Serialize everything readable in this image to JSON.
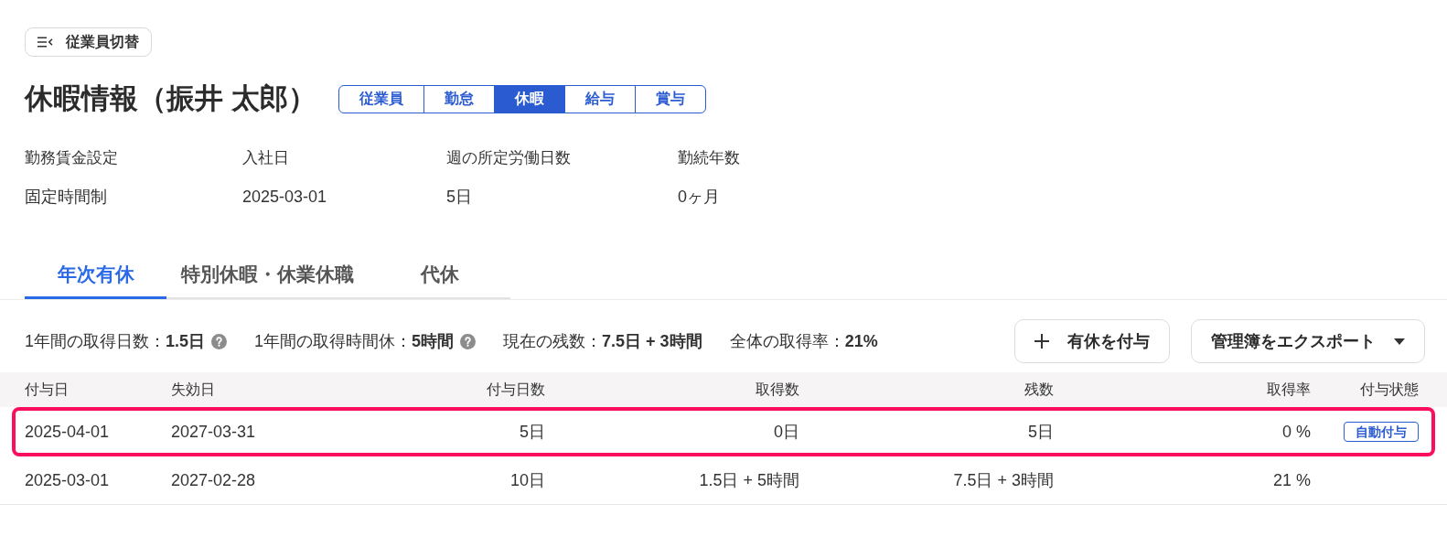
{
  "header": {
    "switch_button": "従業員切替",
    "title": "休暇情報（振井 太郎）"
  },
  "section_tabs": [
    {
      "label": "従業員",
      "selected": false
    },
    {
      "label": "勤怠",
      "selected": false
    },
    {
      "label": "休暇",
      "selected": true
    },
    {
      "label": "給与",
      "selected": false
    },
    {
      "label": "賞与",
      "selected": false
    }
  ],
  "employee_info": [
    {
      "label": "勤務賃金設定",
      "value": "固定時間制"
    },
    {
      "label": "入社日",
      "value": "2025-03-01"
    },
    {
      "label": "週の所定労働日数",
      "value": "5日"
    },
    {
      "label": "勤続年数",
      "value": "0ヶ月"
    }
  ],
  "leave_tabs": [
    {
      "label": "年次有休",
      "selected": true
    },
    {
      "label": "特別休暇・休業休職",
      "selected": false
    },
    {
      "label": "代休",
      "selected": false
    }
  ],
  "summary": [
    {
      "text": "1年間の取得日数：**1.5日**",
      "help": true
    },
    {
      "text": "1年間の取得時間休：**5時間**",
      "help": true
    },
    {
      "text": "現在の残数：**7.5日 + 3時間**",
      "help": false
    },
    {
      "text": "全体の取得率：**21%**",
      "help": false
    }
  ],
  "actions": [
    {
      "kind": "add",
      "label": "有休を付与"
    },
    {
      "kind": "dropdown",
      "label": "管理簿をエクスポート"
    }
  ],
  "table": {
    "columns": [
      "付与日",
      "失効日",
      "付与日数",
      "取得数",
      "残数",
      "取得率",
      "付与状態"
    ],
    "rows": [
      {
        "highlighted": true,
        "cells": [
          "2025-04-01",
          "2027-03-31",
          "5日",
          "0日",
          "5日",
          "0 %"
        ],
        "grant_status": "自動付与"
      },
      {
        "highlighted": false,
        "cells": [
          "2025-03-01",
          "2027-02-28",
          "10日",
          "1.5日 + 5時間",
          "7.5日 + 3時間",
          "21 %"
        ]
      }
    ]
  }
}
